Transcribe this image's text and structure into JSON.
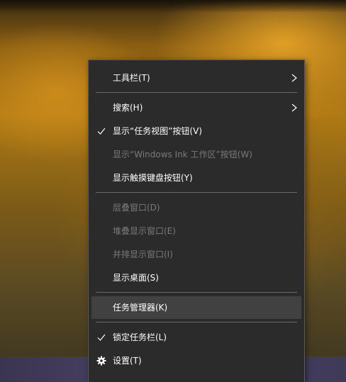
{
  "desktop": {
    "background_color": "#8a5e12",
    "taskbar_color": "#3e3a58"
  },
  "context_menu": {
    "background_color": "#2b2b2b",
    "highlight_color": "#414141",
    "items": [
      {
        "label": "工具栏(T)",
        "state": "enabled",
        "checked": false,
        "submenu": true,
        "icon": "none"
      },
      {
        "label": "搜索(H)",
        "state": "enabled",
        "checked": false,
        "submenu": true,
        "icon": "none"
      },
      {
        "label": "显示“任务视图”按钮(V)",
        "state": "enabled",
        "checked": true,
        "submenu": false,
        "icon": "checkmark-icon"
      },
      {
        "label": "显示“Windows Ink 工作区”按钮(W)",
        "state": "disabled",
        "checked": false,
        "submenu": false,
        "icon": "none"
      },
      {
        "label": "显示触摸键盘按钮(Y)",
        "state": "enabled",
        "checked": false,
        "submenu": false,
        "icon": "none"
      },
      {
        "label": "层叠窗口(D)",
        "state": "disabled",
        "checked": false,
        "submenu": false,
        "icon": "none"
      },
      {
        "label": "堆叠显示窗口(E)",
        "state": "disabled",
        "checked": false,
        "submenu": false,
        "icon": "none"
      },
      {
        "label": "并排显示窗口(I)",
        "state": "disabled",
        "checked": false,
        "submenu": false,
        "icon": "none"
      },
      {
        "label": "显示桌面(S)",
        "state": "enabled",
        "checked": false,
        "submenu": false,
        "icon": "none"
      },
      {
        "label": "任务管理器(K)",
        "state": "highlighted",
        "checked": false,
        "submenu": false,
        "icon": "none"
      },
      {
        "label": "锁定任务栏(L)",
        "state": "enabled",
        "checked": true,
        "submenu": false,
        "icon": "checkmark-icon"
      },
      {
        "label": "设置(T)",
        "state": "enabled",
        "checked": false,
        "submenu": false,
        "icon": "gear-icon"
      }
    ]
  }
}
